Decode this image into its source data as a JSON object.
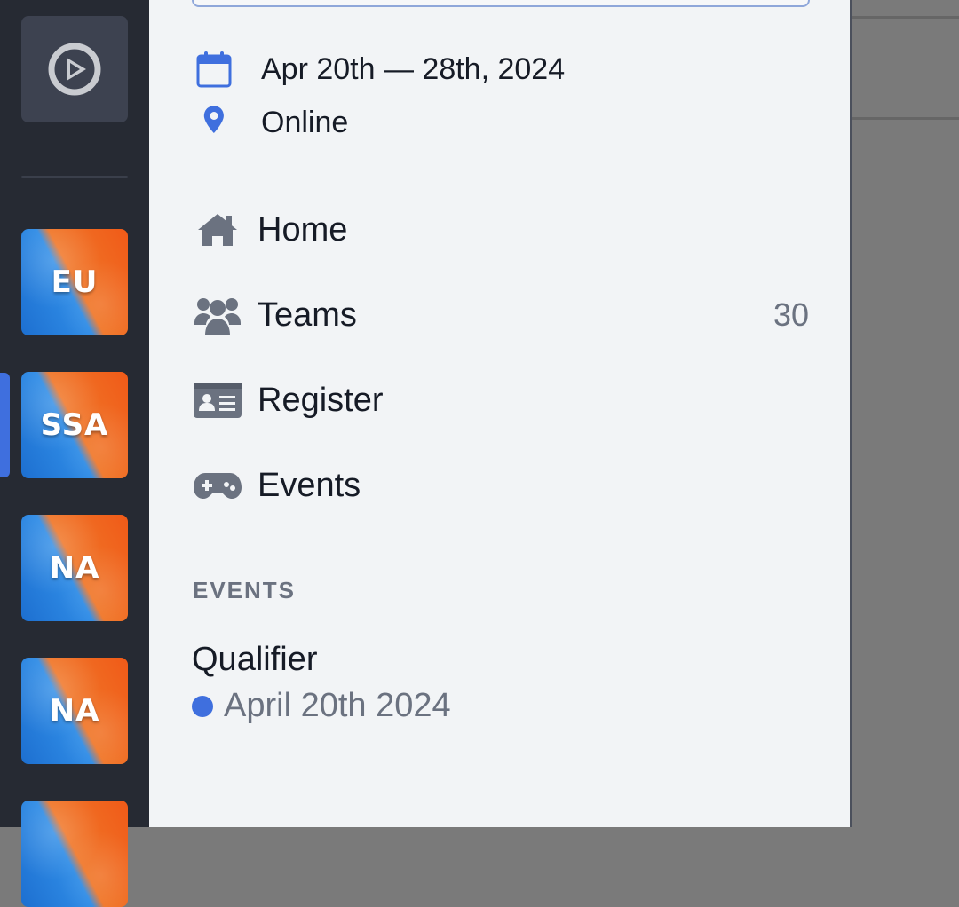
{
  "rail": {
    "home_icon": "compass-icon",
    "servers": [
      {
        "label": "EU"
      },
      {
        "label": "SSA"
      },
      {
        "label": "NA"
      },
      {
        "label": "NA"
      },
      {
        "label": ""
      }
    ],
    "active_index": 1
  },
  "panel": {
    "date_range": "Apr 20th — 28th, 2024",
    "location": "Online",
    "nav": {
      "home": {
        "label": "Home",
        "icon": "home-icon"
      },
      "teams": {
        "label": "Teams",
        "count": "30",
        "icon": "users-icon"
      },
      "register": {
        "label": "Register",
        "icon": "id-card-icon"
      },
      "events": {
        "label": "Events",
        "icon": "gamepad-icon"
      }
    },
    "events_section_title": "EVENTS",
    "events": [
      {
        "name": "Qualifier",
        "date": "April 20th 2024",
        "status_color": "#3f6fde"
      }
    ]
  },
  "colors": {
    "accent": "#3f6fde",
    "rail_bg": "#262a33",
    "panel_bg": "#f2f4f6"
  }
}
